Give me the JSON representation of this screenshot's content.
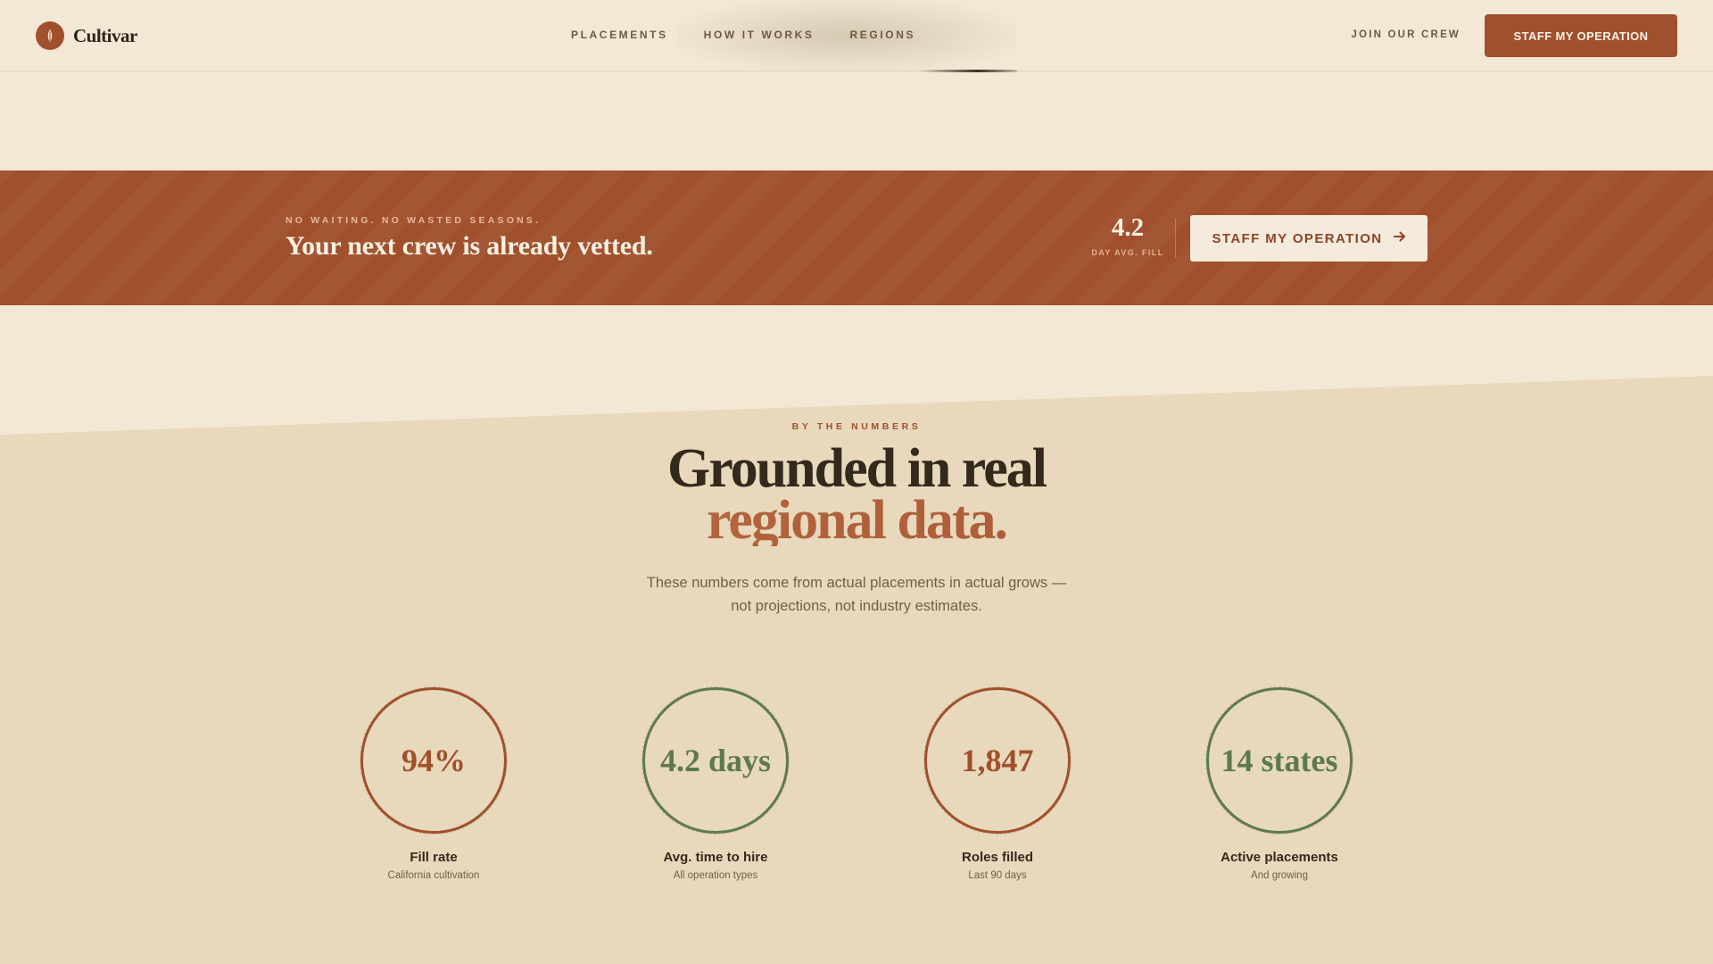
{
  "header": {
    "brand": "Cultivar",
    "nav": [
      {
        "label": "PLACEMENTS"
      },
      {
        "label": "HOW IT WORKS"
      },
      {
        "label": "REGIONS"
      }
    ],
    "join_label": "JOIN OUR CREW",
    "cta_label": "STAFF MY OPERATION"
  },
  "banner": {
    "eyebrow": "NO WAITING. NO WASTED SEASONS.",
    "title": "Your next crew is already vetted.",
    "stat_value": "4.2",
    "stat_label": "DAY AVG. FILL",
    "cta_label": "STAFF MY OPERATION",
    "cta_icon": "arrow-right-icon"
  },
  "numbers": {
    "eyebrow": "BY THE NUMBERS",
    "title_line1": "Grounded in real",
    "title_line2": "regional data.",
    "desc": "These numbers come from actual placements in actual grows — not projections, not industry estimates.",
    "stats": [
      {
        "value": "94%",
        "label": "Fill rate",
        "sub": "California cultivation",
        "color": "#a0502d"
      },
      {
        "value": "4.2 days",
        "label": "Avg. time to hire",
        "sub": "All operation types",
        "color": "#5d7a4e"
      },
      {
        "value": "1,847",
        "label": "Roles filled",
        "sub": "Last 90 days",
        "color": "#a0502d"
      },
      {
        "value": "14 states",
        "label": "Active placements",
        "sub": "And growing",
        "color": "#5d7a4e"
      }
    ]
  },
  "colors": {
    "accent": "#a0502d",
    "green": "#5d7a4e",
    "background": "#f3e8d6",
    "section_background": "#e8d9bc"
  }
}
